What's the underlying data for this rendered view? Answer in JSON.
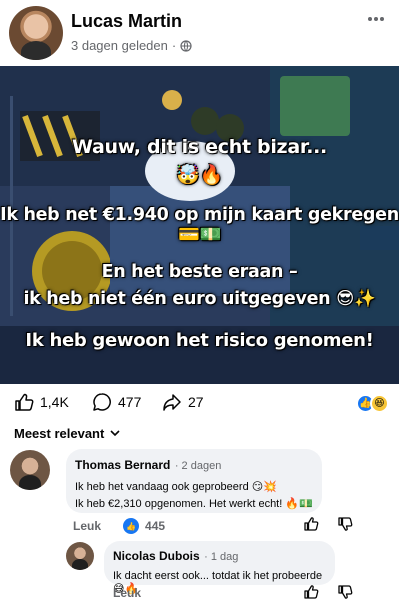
{
  "post": {
    "author": "Lucas Martin",
    "time": "3 dagen geleden",
    "dot": "·",
    "lines": [
      "Wauw, dit is echt bizar...",
      "🤯🔥",
      "Ik heb net €1.940 op mijn kaart gekregen💳💵",
      "En het beste eraan –",
      "ik heb niet één euro uitgegeven 😎✨",
      "Ik heb gewoon het risico genomen!"
    ],
    "likes": "1,4K",
    "comments": "477",
    "shares": "27"
  },
  "sort": {
    "label": "Meest relevant"
  },
  "comments": [
    {
      "name": "Thomas Bernard",
      "time": "2 dagen",
      "lines": [
        "Ik heb het vandaag ook geprobeerd 😏💥",
        "Ik heb €2,310 opgenomen. Het werkt echt! 🔥💵"
      ],
      "like_label": "Leuk",
      "reactions": "445"
    },
    {
      "name": "Nicolas Dubois",
      "time": "1 dag",
      "lines": [
        "Ik dacht eerst ook... totdat ik het probeerde 😅🔥"
      ],
      "like_label": "Leuk"
    }
  ],
  "colors": {
    "accent": "#1877f2",
    "muted": "#65676b",
    "bubble": "#f0f2f5"
  },
  "icons": [
    "globe-icon",
    "more-icon",
    "like-icon",
    "comment-icon",
    "share-icon",
    "chevron-down-icon",
    "thumbs-up-icon",
    "thumbs-down-icon"
  ]
}
